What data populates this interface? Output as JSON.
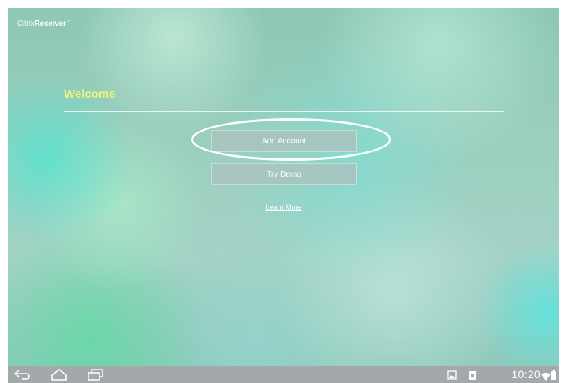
{
  "app": {
    "brand_citrix": "Citrix",
    "brand_receiver": "Receiver",
    "brand_tm": "™"
  },
  "welcome": {
    "title": "Welcome"
  },
  "actions": {
    "add_account": "Add Account",
    "try_demo": "Try Demo",
    "learn_more": "Learn More"
  },
  "status_bar": {
    "time": "10:20"
  },
  "colors": {
    "welcome_text": "#ebf27d",
    "button_bg": "#aac3be",
    "nav_bar": "#a3a9ab"
  },
  "icons": {
    "nav": [
      "back-icon",
      "home-icon",
      "recent-apps-icon"
    ],
    "status": [
      "gallery-notification-icon",
      "download-notification-icon",
      "wifi-icon",
      "battery-icon"
    ]
  }
}
